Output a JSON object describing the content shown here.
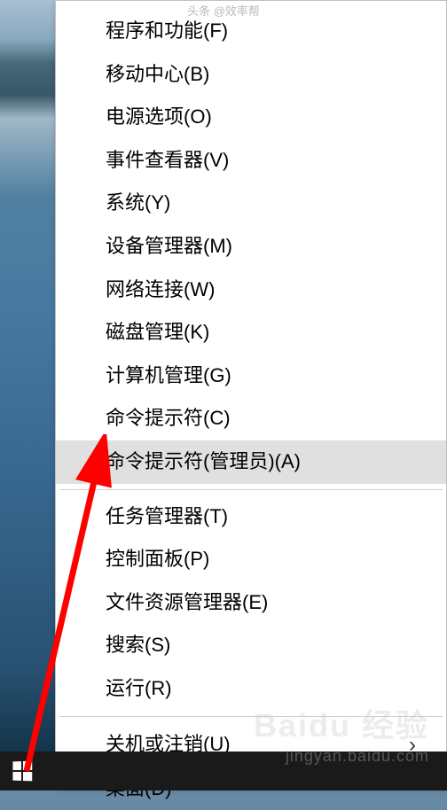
{
  "watermarks": {
    "top": "头条 @效率帮",
    "brand": "Baidu 经验",
    "url": "jingyan.baidu.com"
  },
  "menu": {
    "groups": [
      [
        {
          "label": "程序和功能(F)",
          "name": "menu-programs-features",
          "highlighted": false,
          "submenu": false
        },
        {
          "label": "移动中心(B)",
          "name": "menu-mobility-center",
          "highlighted": false,
          "submenu": false
        },
        {
          "label": "电源选项(O)",
          "name": "menu-power-options",
          "highlighted": false,
          "submenu": false
        },
        {
          "label": "事件查看器(V)",
          "name": "menu-event-viewer",
          "highlighted": false,
          "submenu": false
        },
        {
          "label": "系统(Y)",
          "name": "menu-system",
          "highlighted": false,
          "submenu": false
        },
        {
          "label": "设备管理器(M)",
          "name": "menu-device-manager",
          "highlighted": false,
          "submenu": false
        },
        {
          "label": "网络连接(W)",
          "name": "menu-network-connections",
          "highlighted": false,
          "submenu": false
        },
        {
          "label": "磁盘管理(K)",
          "name": "menu-disk-management",
          "highlighted": false,
          "submenu": false
        },
        {
          "label": "计算机管理(G)",
          "name": "menu-computer-management",
          "highlighted": false,
          "submenu": false
        },
        {
          "label": "命令提示符(C)",
          "name": "menu-command-prompt",
          "highlighted": false,
          "submenu": false
        },
        {
          "label": "命令提示符(管理员)(A)",
          "name": "menu-command-prompt-admin",
          "highlighted": true,
          "submenu": false
        }
      ],
      [
        {
          "label": "任务管理器(T)",
          "name": "menu-task-manager",
          "highlighted": false,
          "submenu": false
        },
        {
          "label": "控制面板(P)",
          "name": "menu-control-panel",
          "highlighted": false,
          "submenu": false
        },
        {
          "label": "文件资源管理器(E)",
          "name": "menu-file-explorer",
          "highlighted": false,
          "submenu": false
        },
        {
          "label": "搜索(S)",
          "name": "menu-search",
          "highlighted": false,
          "submenu": false
        },
        {
          "label": "运行(R)",
          "name": "menu-run",
          "highlighted": false,
          "submenu": false
        }
      ],
      [
        {
          "label": "关机或注销(U)",
          "name": "menu-shutdown-signout",
          "highlighted": false,
          "submenu": true
        },
        {
          "label": "桌面(D)",
          "name": "menu-desktop",
          "highlighted": false,
          "submenu": false
        }
      ]
    ]
  }
}
